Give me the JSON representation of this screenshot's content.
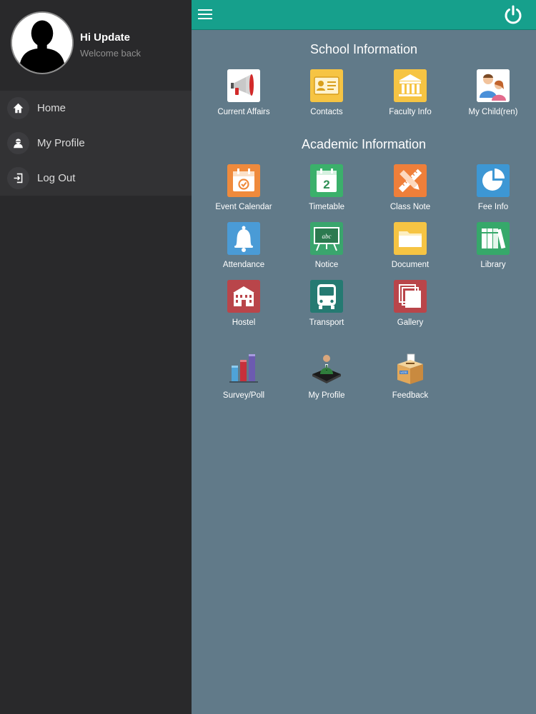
{
  "user": {
    "greeting": "Hi Update",
    "subtitle": "Welcome back"
  },
  "sidebar": {
    "items": [
      {
        "label": "Home",
        "icon": "home-icon"
      },
      {
        "label": "My Profile",
        "icon": "user-icon"
      },
      {
        "label": "Log Out",
        "icon": "logout-icon"
      }
    ]
  },
  "header": {
    "menu_icon": "hamburger-icon",
    "power_icon": "power-icon",
    "accent_color": "#16a08c"
  },
  "school_section": {
    "title": "School Information",
    "items": [
      {
        "label": "Current Affairs",
        "icon": "megaphone-icon",
        "color": "#ffffff"
      },
      {
        "label": "Contacts",
        "icon": "contact-card-icon",
        "color": "#f6c443"
      },
      {
        "label": "Faculty Info",
        "icon": "institution-icon",
        "color": "#f6c443"
      },
      {
        "label": "My Child(ren)",
        "icon": "children-icon",
        "color": "#ffffff"
      }
    ]
  },
  "academic_section": {
    "title": "Academic Information",
    "items": [
      {
        "label": "Event Calendar",
        "icon": "calendar-icon",
        "color": "#ef8a3c"
      },
      {
        "label": "Timetable",
        "icon": "timetable-icon",
        "color": "#3bb06b"
      },
      {
        "label": "Class Note",
        "icon": "pencil-ruler-icon",
        "color": "#ef7f3a"
      },
      {
        "label": "Fee Info",
        "icon": "pie-chart-icon",
        "color": "#3d97d4"
      },
      {
        "label": "Attendance",
        "icon": "bell-icon",
        "color": "#4a9bd6"
      },
      {
        "label": "Notice",
        "icon": "chalkboard-icon",
        "color": "#3aa56d"
      },
      {
        "label": "Document",
        "icon": "folder-icon",
        "color": "#f6c443"
      },
      {
        "label": "Library",
        "icon": "books-icon",
        "color": "#36a86a"
      },
      {
        "label": "Hostel",
        "icon": "building-icon",
        "color": "#b9454a"
      },
      {
        "label": "Transport",
        "icon": "bus-icon",
        "color": "#257a72"
      },
      {
        "label": "Gallery",
        "icon": "gallery-icon",
        "color": "#b9454a"
      },
      {
        "label": "Survey/Poll",
        "icon": "bar-chart-icon",
        "color": "#617a89"
      },
      {
        "label": "My Profile",
        "icon": "businessman-icon",
        "color": "#617a89"
      },
      {
        "label": "Feedback",
        "icon": "ballot-box-icon",
        "color": "#617a89"
      }
    ]
  }
}
